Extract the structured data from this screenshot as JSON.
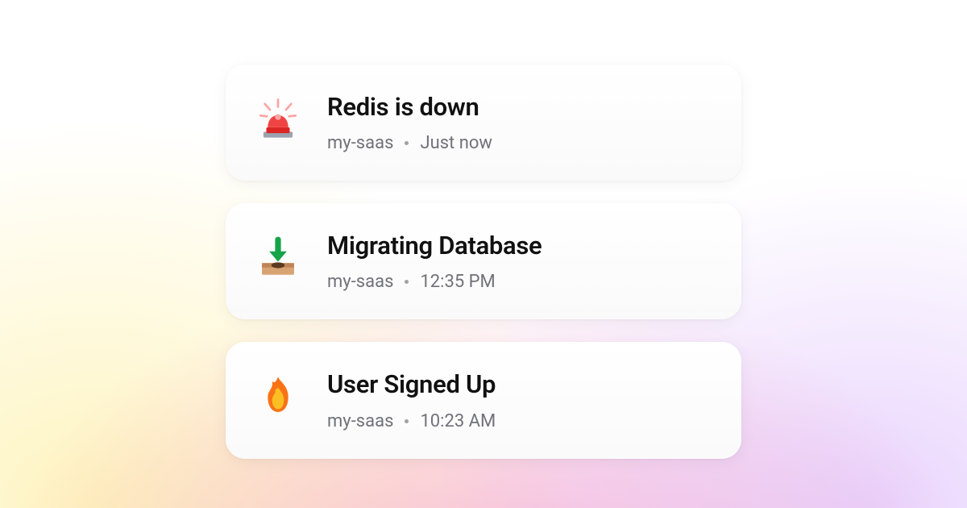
{
  "notifications": [
    {
      "title": "Redis is down",
      "project": "my-saas",
      "time": "Just now",
      "icon": "siren"
    },
    {
      "title": "Migrating Database",
      "project": "my-saas",
      "time": "12:35 PM",
      "icon": "inbox-arrow"
    },
    {
      "title": "User Signed Up",
      "project": "my-saas",
      "time": "10:23 AM",
      "icon": "fire"
    }
  ]
}
